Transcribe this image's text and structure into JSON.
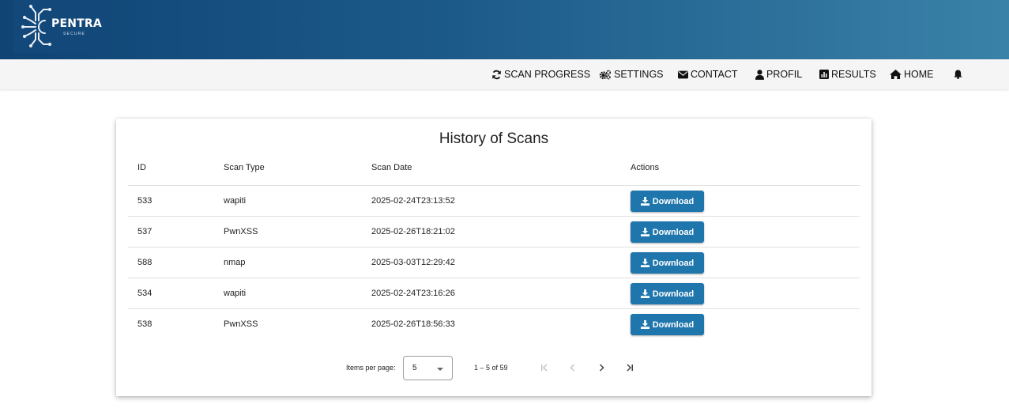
{
  "brand": {
    "name": "PENTRA",
    "tagline": "SECURE",
    "colors": {
      "header_start": "#0f4475",
      "header_end": "#3a82a8",
      "accent": "#1f76ad"
    }
  },
  "nav": {
    "items": [
      {
        "label": "SCAN PROGRESS",
        "icon": "refresh-icon"
      },
      {
        "label": "SETTINGS",
        "icon": "gears-icon"
      },
      {
        "label": "CONTACT",
        "icon": "envelope-icon"
      },
      {
        "label": "PROFIL",
        "icon": "user-icon"
      },
      {
        "label": "RESULTS",
        "icon": "bar-chart-icon"
      },
      {
        "label": "HOME",
        "icon": "home-icon"
      }
    ],
    "notification_icon": "bell-icon"
  },
  "history": {
    "title": "History of Scans",
    "columns": [
      "ID",
      "Scan Type",
      "Scan Date",
      "Actions"
    ],
    "rows": [
      {
        "id": "533",
        "type": "wapiti",
        "date": "2025-02-24T23:13:52",
        "action": "Download"
      },
      {
        "id": "537",
        "type": "PwnXSS",
        "date": "2025-02-26T18:21:02",
        "action": "Download"
      },
      {
        "id": "588",
        "type": "nmap",
        "date": "2025-03-03T12:29:42",
        "action": "Download"
      },
      {
        "id": "534",
        "type": "wapiti",
        "date": "2025-02-24T23:16:26",
        "action": "Download"
      },
      {
        "id": "538",
        "type": "PwnXSS",
        "date": "2025-02-26T18:56:33",
        "action": "Download"
      }
    ]
  },
  "paginator": {
    "items_per_page_label": "Items per page:",
    "items_per_page_value": "5",
    "range_label": "1 – 5 of 59",
    "buttons": [
      "first-page-icon",
      "previous-page-icon",
      "next-page-icon",
      "last-page-icon"
    ]
  }
}
